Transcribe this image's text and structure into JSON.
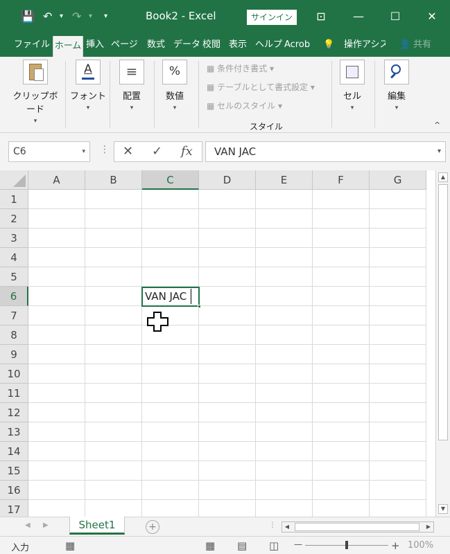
{
  "titlebar": {
    "title": "Book2  -  Excel",
    "signin_label": "サインイン",
    "save_glyph": "💾",
    "undo_glyph": "↶",
    "redo_glyph": "↷",
    "qa_dropdown_glyph": "▾",
    "display_options_glyph": "⊡",
    "minimize_glyph": "—",
    "maximize_glyph": "☐",
    "close_glyph": "✕"
  },
  "tabs": [
    {
      "label": "ファイル"
    },
    {
      "label": "ホーム"
    },
    {
      "label": "挿入"
    },
    {
      "label": "ページ l"
    },
    {
      "label": "数式"
    },
    {
      "label": "データ"
    },
    {
      "label": "校閲"
    },
    {
      "label": "表示"
    },
    {
      "label": "ヘルプ"
    },
    {
      "label": "Acrob"
    },
    {
      "label": "操作アシス"
    },
    {
      "label": "共有"
    }
  ],
  "ribbon": {
    "clipboard": "クリップボード",
    "font": "フォント",
    "alignment": "配置",
    "number": "数値",
    "conditional_format": "条件付き書式",
    "table_format": "テーブルとして書式設定",
    "cell_styles": "セルのスタイル",
    "styles_group": "スタイル",
    "cells": "セル",
    "editing": "編集",
    "dropdown_glyph": "▾",
    "collapse_glyph": "^",
    "font_icon_glyph": "A",
    "alignment_icon_glyph": "≡",
    "number_icon_glyph": "%"
  },
  "formula_bar": {
    "name_box": "C6",
    "dropdown_glyph": "▾",
    "cancel_glyph": "✕",
    "enter_glyph": "✓",
    "fx_glyph": "fx",
    "content": "VAN JAC"
  },
  "grid": {
    "columns": [
      "A",
      "B",
      "C",
      "D",
      "E",
      "F",
      "G"
    ],
    "rows": [
      "1",
      "2",
      "3",
      "4",
      "5",
      "6",
      "7",
      "8",
      "9",
      "10",
      "11",
      "12",
      "13",
      "14",
      "15",
      "16",
      "17"
    ],
    "selected_column": "C",
    "selected_row": "6",
    "active_cell_value": "VAN JAC"
  },
  "sheet_tabs": {
    "sheets": [
      "Sheet1"
    ],
    "add_glyph": "+",
    "nav_prev_glyph": "◀",
    "nav_next_glyph": "▶",
    "scroll_left_glyph": "◀",
    "scroll_right_glyph": "▶",
    "scroll_up_glyph": "▲",
    "scroll_down_glyph": "▼"
  },
  "statusbar": {
    "mode": "入力",
    "zoom_minus": "—",
    "zoom_plus": "+",
    "zoom": "100%"
  },
  "colors": {
    "brand": "#217346",
    "ribbon_bg": "#f3f3f3",
    "header_bg": "#e6e6e6"
  }
}
